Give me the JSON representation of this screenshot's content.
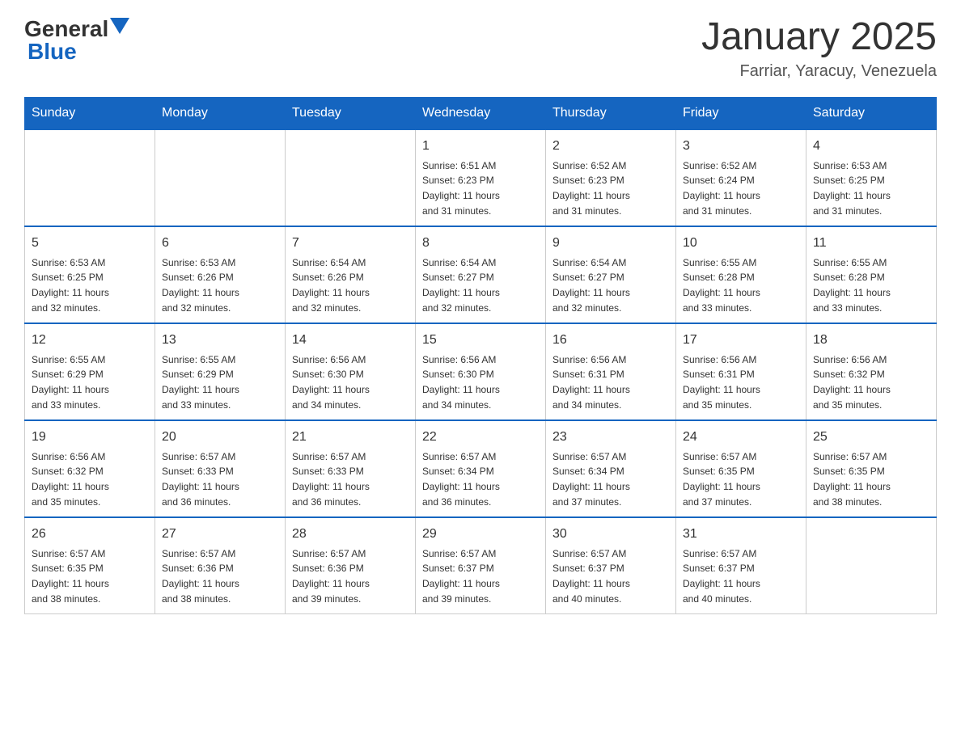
{
  "header": {
    "logo_general": "General",
    "logo_blue": "Blue",
    "title": "January 2025",
    "subtitle": "Farriar, Yaracuy, Venezuela"
  },
  "days_of_week": [
    "Sunday",
    "Monday",
    "Tuesday",
    "Wednesday",
    "Thursday",
    "Friday",
    "Saturday"
  ],
  "weeks": [
    [
      {
        "day": "",
        "info": ""
      },
      {
        "day": "",
        "info": ""
      },
      {
        "day": "",
        "info": ""
      },
      {
        "day": "1",
        "info": "Sunrise: 6:51 AM\nSunset: 6:23 PM\nDaylight: 11 hours\nand 31 minutes."
      },
      {
        "day": "2",
        "info": "Sunrise: 6:52 AM\nSunset: 6:23 PM\nDaylight: 11 hours\nand 31 minutes."
      },
      {
        "day": "3",
        "info": "Sunrise: 6:52 AM\nSunset: 6:24 PM\nDaylight: 11 hours\nand 31 minutes."
      },
      {
        "day": "4",
        "info": "Sunrise: 6:53 AM\nSunset: 6:25 PM\nDaylight: 11 hours\nand 31 minutes."
      }
    ],
    [
      {
        "day": "5",
        "info": "Sunrise: 6:53 AM\nSunset: 6:25 PM\nDaylight: 11 hours\nand 32 minutes."
      },
      {
        "day": "6",
        "info": "Sunrise: 6:53 AM\nSunset: 6:26 PM\nDaylight: 11 hours\nand 32 minutes."
      },
      {
        "day": "7",
        "info": "Sunrise: 6:54 AM\nSunset: 6:26 PM\nDaylight: 11 hours\nand 32 minutes."
      },
      {
        "day": "8",
        "info": "Sunrise: 6:54 AM\nSunset: 6:27 PM\nDaylight: 11 hours\nand 32 minutes."
      },
      {
        "day": "9",
        "info": "Sunrise: 6:54 AM\nSunset: 6:27 PM\nDaylight: 11 hours\nand 32 minutes."
      },
      {
        "day": "10",
        "info": "Sunrise: 6:55 AM\nSunset: 6:28 PM\nDaylight: 11 hours\nand 33 minutes."
      },
      {
        "day": "11",
        "info": "Sunrise: 6:55 AM\nSunset: 6:28 PM\nDaylight: 11 hours\nand 33 minutes."
      }
    ],
    [
      {
        "day": "12",
        "info": "Sunrise: 6:55 AM\nSunset: 6:29 PM\nDaylight: 11 hours\nand 33 minutes."
      },
      {
        "day": "13",
        "info": "Sunrise: 6:55 AM\nSunset: 6:29 PM\nDaylight: 11 hours\nand 33 minutes."
      },
      {
        "day": "14",
        "info": "Sunrise: 6:56 AM\nSunset: 6:30 PM\nDaylight: 11 hours\nand 34 minutes."
      },
      {
        "day": "15",
        "info": "Sunrise: 6:56 AM\nSunset: 6:30 PM\nDaylight: 11 hours\nand 34 minutes."
      },
      {
        "day": "16",
        "info": "Sunrise: 6:56 AM\nSunset: 6:31 PM\nDaylight: 11 hours\nand 34 minutes."
      },
      {
        "day": "17",
        "info": "Sunrise: 6:56 AM\nSunset: 6:31 PM\nDaylight: 11 hours\nand 35 minutes."
      },
      {
        "day": "18",
        "info": "Sunrise: 6:56 AM\nSunset: 6:32 PM\nDaylight: 11 hours\nand 35 minutes."
      }
    ],
    [
      {
        "day": "19",
        "info": "Sunrise: 6:56 AM\nSunset: 6:32 PM\nDaylight: 11 hours\nand 35 minutes."
      },
      {
        "day": "20",
        "info": "Sunrise: 6:57 AM\nSunset: 6:33 PM\nDaylight: 11 hours\nand 36 minutes."
      },
      {
        "day": "21",
        "info": "Sunrise: 6:57 AM\nSunset: 6:33 PM\nDaylight: 11 hours\nand 36 minutes."
      },
      {
        "day": "22",
        "info": "Sunrise: 6:57 AM\nSunset: 6:34 PM\nDaylight: 11 hours\nand 36 minutes."
      },
      {
        "day": "23",
        "info": "Sunrise: 6:57 AM\nSunset: 6:34 PM\nDaylight: 11 hours\nand 37 minutes."
      },
      {
        "day": "24",
        "info": "Sunrise: 6:57 AM\nSunset: 6:35 PM\nDaylight: 11 hours\nand 37 minutes."
      },
      {
        "day": "25",
        "info": "Sunrise: 6:57 AM\nSunset: 6:35 PM\nDaylight: 11 hours\nand 38 minutes."
      }
    ],
    [
      {
        "day": "26",
        "info": "Sunrise: 6:57 AM\nSunset: 6:35 PM\nDaylight: 11 hours\nand 38 minutes."
      },
      {
        "day": "27",
        "info": "Sunrise: 6:57 AM\nSunset: 6:36 PM\nDaylight: 11 hours\nand 38 minutes."
      },
      {
        "day": "28",
        "info": "Sunrise: 6:57 AM\nSunset: 6:36 PM\nDaylight: 11 hours\nand 39 minutes."
      },
      {
        "day": "29",
        "info": "Sunrise: 6:57 AM\nSunset: 6:37 PM\nDaylight: 11 hours\nand 39 minutes."
      },
      {
        "day": "30",
        "info": "Sunrise: 6:57 AM\nSunset: 6:37 PM\nDaylight: 11 hours\nand 40 minutes."
      },
      {
        "day": "31",
        "info": "Sunrise: 6:57 AM\nSunset: 6:37 PM\nDaylight: 11 hours\nand 40 minutes."
      },
      {
        "day": "",
        "info": ""
      }
    ]
  ]
}
